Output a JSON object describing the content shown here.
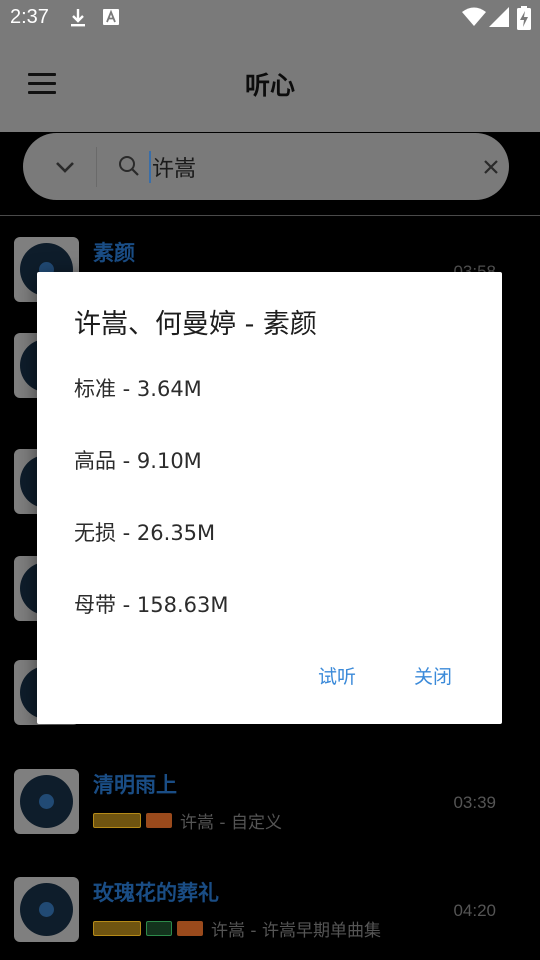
{
  "status_bar": {
    "time": "2:37",
    "icons": [
      "download-icon",
      "font-a-icon",
      "wifi-icon",
      "signal-icon",
      "battery-charging-icon"
    ]
  },
  "app_bar": {
    "title": "听心"
  },
  "search": {
    "value": "许嵩",
    "placeholder": ""
  },
  "songs": [
    {
      "name": "素颜",
      "duration": "03:58",
      "meta": ""
    },
    {
      "name": "清明雨上",
      "duration": "03:39",
      "tags": [
        "gold",
        "orange"
      ],
      "meta": "许嵩 - 自定义"
    },
    {
      "name": "玫瑰花的葬礼",
      "duration": "04:20",
      "tags": [
        "gold",
        "green",
        "orange"
      ],
      "meta": "许嵩 - 许嵩早期单曲集"
    }
  ],
  "dialog": {
    "title": "许嵩、何曼婷 - 素颜",
    "options": [
      {
        "label": "标准 - 3.64M"
      },
      {
        "label": "高品 - 9.10M"
      },
      {
        "label": "无损 - 26.35M"
      },
      {
        "label": "母带 - 158.63M"
      }
    ],
    "preview_label": "试听",
    "close_label": "关闭"
  },
  "colors": {
    "accent": "#3b8ad9",
    "song_title": "#1a4d85",
    "bar": "#7a7a7a"
  }
}
